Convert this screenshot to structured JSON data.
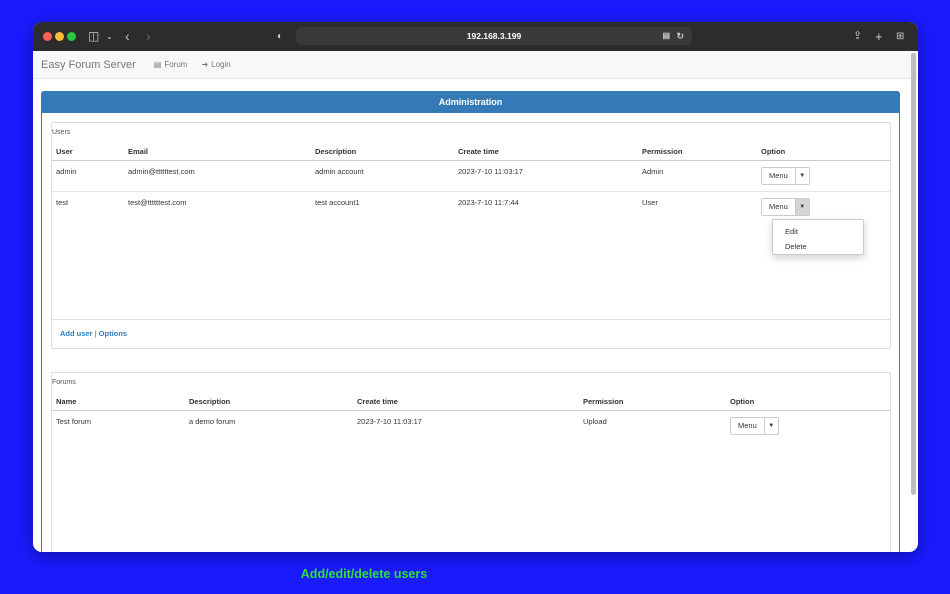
{
  "browser": {
    "url": "192.168.3.199",
    "icons": [
      "sidebar-icon",
      "chevron-down-icon",
      "back-icon",
      "forward-icon",
      "shield-icon",
      "translate-icon",
      "reload-icon",
      "share-icon",
      "new-tab-icon",
      "tabs-overview-icon"
    ]
  },
  "navbar": {
    "brand": "Easy Forum Server",
    "forum_label": "Forum",
    "login_label": "Login"
  },
  "admin": {
    "heading": "Administration",
    "users": {
      "title": "Users",
      "columns": [
        "User",
        "Email",
        "Description",
        "Create time",
        "Permission",
        "Option"
      ],
      "rows": [
        {
          "user": "admin",
          "email": "admin@ttttttest.com",
          "description": "admin account",
          "create_time": "2023-7-10 11:03:17",
          "permission": "Admin",
          "menu": "Menu"
        },
        {
          "user": "test",
          "email": "test@ttttttest.com",
          "description": "test account1",
          "create_time": "2023-7-10 11:7:44",
          "permission": "User",
          "menu": "Menu"
        }
      ],
      "dropdown": [
        "Edit",
        "Delete"
      ],
      "footer": {
        "add_user": "Add user",
        "separator": "|",
        "options": "Options"
      }
    },
    "forums": {
      "title": "Forums",
      "columns": [
        "Name",
        "Description",
        "Create time",
        "Permission",
        "Option"
      ],
      "rows": [
        {
          "name": "Test forum",
          "description": "a demo forum",
          "create_time": "2023-7-10 11:03:17",
          "permission": "Upload",
          "menu": "Menu"
        }
      ]
    }
  },
  "caption": "Add/edit/delete users"
}
